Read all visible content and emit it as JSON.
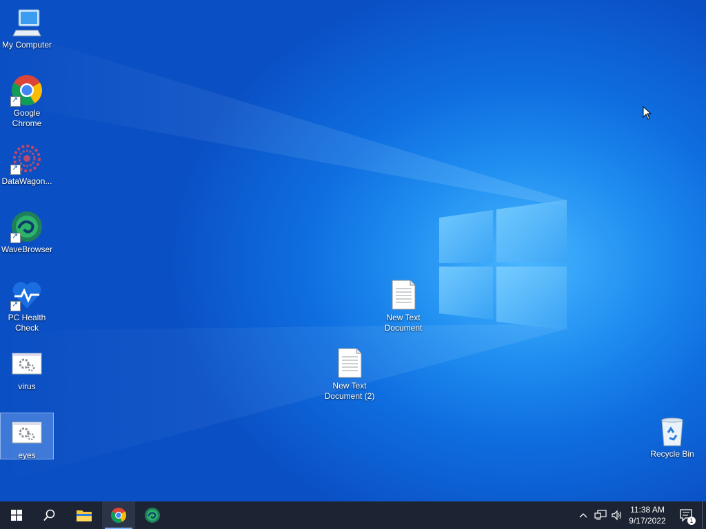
{
  "desktop": {
    "icons": [
      {
        "label": "My Computer"
      },
      {
        "label": "Google\nChrome"
      },
      {
        "label": "DataWagon..."
      },
      {
        "label": "WaveBrowser"
      },
      {
        "label": "PC Health\nCheck"
      },
      {
        "label": "virus"
      },
      {
        "label": "eyes"
      },
      {
        "label": "New Text\nDocument"
      },
      {
        "label": "New Text\nDocument (2)"
      },
      {
        "label": "Recycle Bin"
      }
    ],
    "selected_icon": "eyes"
  },
  "taskbar": {
    "clock_time": "11:38 AM",
    "clock_date": "9/17/2022",
    "notification_count": "1",
    "pinned": [
      "start",
      "search",
      "file-explorer",
      "google-chrome",
      "wavebrowser"
    ],
    "active_app": "google-chrome"
  },
  "colors": {
    "taskbar_bg": "#1c2433",
    "wallpaper_base": "#0a5fd0",
    "accent": "#7fb4ff"
  }
}
